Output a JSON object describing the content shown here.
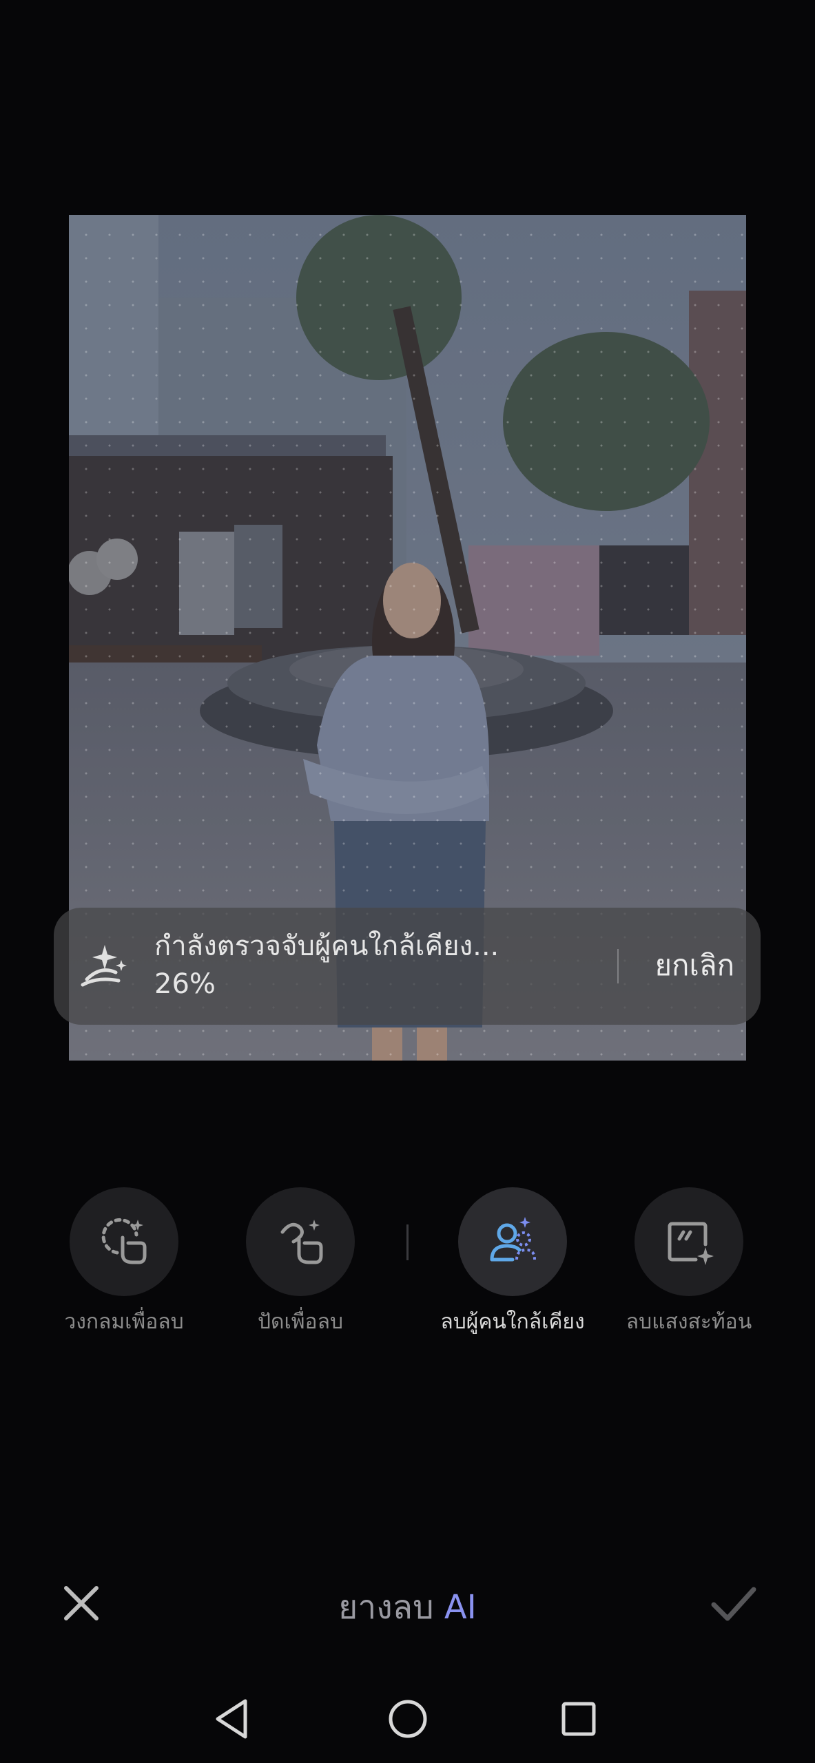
{
  "progress": {
    "status_text": "กำลังตรวจจับผู้คนใกล้เคียง...",
    "percent": "26%",
    "cancel_label": "ยกเลิก",
    "icon": "magic-wand-icon"
  },
  "tools": [
    {
      "label": "วงกลมเพื่อลบ",
      "icon": "circle-select-icon",
      "active": false
    },
    {
      "label": "ปัดเพื่อลบ",
      "icon": "brush-swipe-icon",
      "active": false
    },
    {
      "label": "ลบผู้คนใกล้เคียง",
      "icon": "people-remove-icon",
      "active": true
    },
    {
      "label": "ลบแสงสะท้อน",
      "icon": "reflection-remove-icon",
      "active": false
    }
  ],
  "bottom_bar": {
    "close_icon": "close-icon",
    "title_thai": "ยางลบ",
    "title_ai": "AI",
    "confirm_icon": "check-icon"
  },
  "nav": {
    "back": "back-icon",
    "home": "home-icon",
    "recents": "recents-icon"
  },
  "colors": {
    "accent": "#8a92f0",
    "active_icon": "#5fa8e8",
    "background": "#060608"
  }
}
